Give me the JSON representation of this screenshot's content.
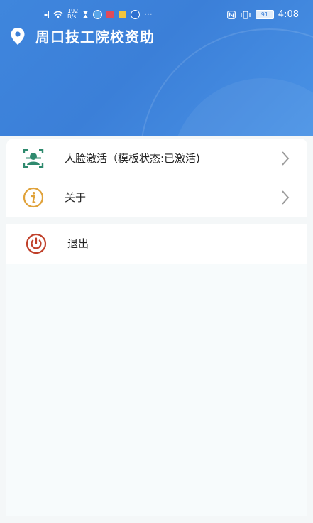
{
  "status_bar": {
    "net_speed_top": "192",
    "net_speed_bottom": "B/s",
    "dots": "···",
    "battery": "91",
    "time": "4:08"
  },
  "header": {
    "title": "周口技工院校资助",
    "location_icon": "location-pin-icon"
  },
  "menu": {
    "items": [
      {
        "label": "人脸激活（模板状态:已激活)",
        "icon": "face-scan-icon",
        "color": "#2f8a6e"
      },
      {
        "label": "关于",
        "icon": "info-icon",
        "color": "#e0a23a"
      }
    ],
    "logout": {
      "label": "退出",
      "icon": "power-icon",
      "color": "#c0402a"
    }
  },
  "colors": {
    "header_blue": "#3b7fd8",
    "chevron": "#9a9a9a"
  }
}
